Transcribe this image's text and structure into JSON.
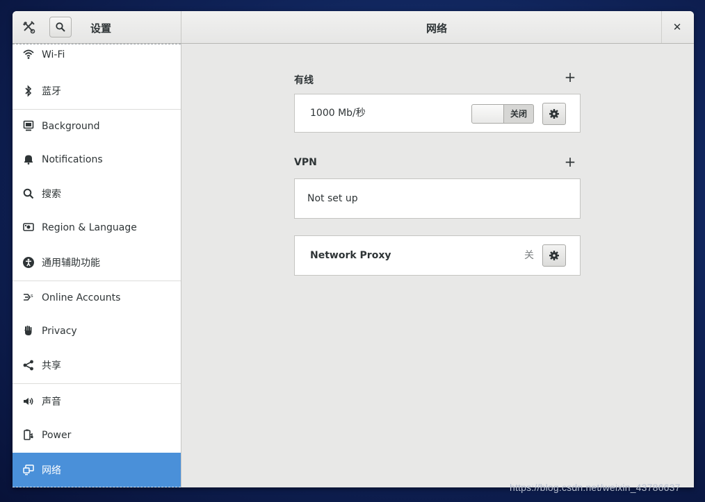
{
  "header": {
    "sidebar_title": "设置",
    "main_title": "网络",
    "close_glyph": "✕"
  },
  "sidebar": {
    "items": [
      {
        "label": "Wi-Fi",
        "icon": "wifi-icon"
      },
      {
        "label": "蓝牙",
        "icon": "bluetooth-icon"
      },
      {
        "label": "Background",
        "icon": "background-icon"
      },
      {
        "label": "Notifications",
        "icon": "bell-icon"
      },
      {
        "label": "搜索",
        "icon": "search-icon"
      },
      {
        "label": "Region & Language",
        "icon": "region-icon"
      },
      {
        "label": "通用辅助功能",
        "icon": "accessibility-icon"
      },
      {
        "label": "Online Accounts",
        "icon": "online-accounts-icon"
      },
      {
        "label": "Privacy",
        "icon": "hand-icon"
      },
      {
        "label": "共享",
        "icon": "share-icon"
      },
      {
        "label": "声音",
        "icon": "speaker-icon"
      },
      {
        "label": "Power",
        "icon": "power-icon"
      },
      {
        "label": "网络",
        "icon": "network-icon",
        "selected": true
      }
    ]
  },
  "main": {
    "wired": {
      "title": "有线",
      "add": "+",
      "connection_label": "1000 Mb/秒",
      "toggle_label": "关闭",
      "toggle_on": false
    },
    "vpn": {
      "title": "VPN",
      "add": "+",
      "status": "Not set up"
    },
    "proxy": {
      "label": "Network Proxy",
      "status": "关"
    }
  },
  "watermark": "https://blog.csdn.net/weixin_43786637",
  "colors": {
    "accent": "#4a90d9",
    "window_bg": "#e8e8e7",
    "text": "#2e3436"
  }
}
